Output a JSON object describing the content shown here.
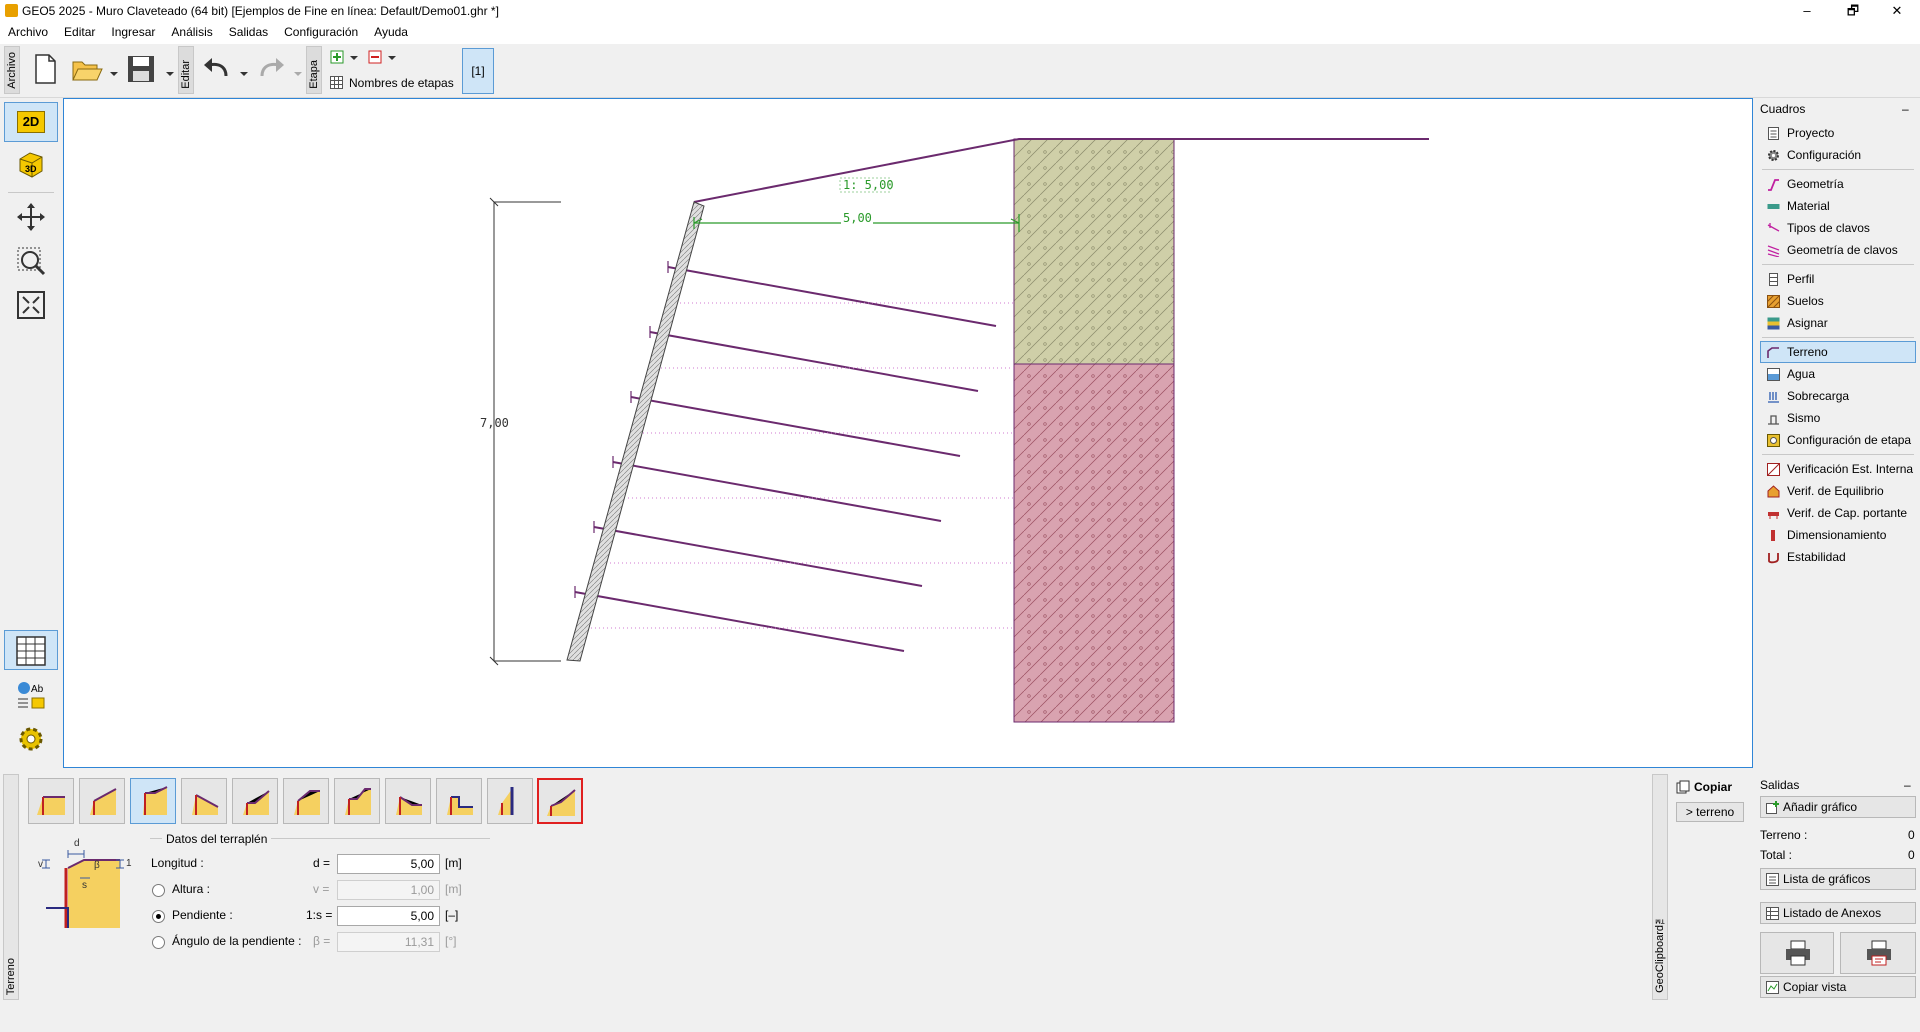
{
  "window": {
    "title": "GEO5 2025 - Muro Claveteado (64 bit) [Ejemplos de Fine en línea: Default/Demo01.ghr *]",
    "minimize": "–",
    "maximize": "🗗",
    "close": "✕"
  },
  "menu": [
    "Archivo",
    "Editar",
    "Ingresar",
    "Análisis",
    "Salidas",
    "Configuración",
    "Ayuda"
  ],
  "toolbar": {
    "tab_archivo": "Archivo",
    "tab_editar": "Editar",
    "tab_etapa": "Etapa",
    "stage_names": "Nombres de etapas",
    "stage_button": "[1]"
  },
  "left_tools": {
    "btn_2d": "2D",
    "btn_3d": "3D"
  },
  "drawing": {
    "slope_label": "1: 5,00",
    "length_label": "5,00",
    "height_label": "7,00"
  },
  "right_panel": {
    "title": "Cuadros",
    "collapse": "–",
    "items": [
      "Proyecto",
      "Configuración",
      "Geometría",
      "Material",
      "Tipos de clavos",
      "Geometría de clavos",
      "Perfil",
      "Suelos",
      "Asignar",
      "Terreno",
      "Agua",
      "Sobrecarga",
      "Sismo",
      "Configuración de etapa",
      "Verificación Est. Interna",
      "Verif. de Equilibrio",
      "Verif. de Cap. portante",
      "Dimensionamiento",
      "Estabilidad"
    ]
  },
  "bottom": {
    "side_tab": "Terreno",
    "group_title": "Datos del terraplén",
    "sketch_labels": {
      "d": "d",
      "v": "v",
      "beta": "β",
      "s": "s",
      "one": "1"
    },
    "rows": [
      {
        "label": "Longitud :",
        "symbol": "d =",
        "value": "5,00",
        "unit": "[m]"
      },
      {
        "label": "Altura :",
        "symbol": "v =",
        "value": "1,00",
        "unit": "[m]"
      },
      {
        "label": "Pendiente :",
        "symbol": "1:s =",
        "value": "5,00",
        "unit": "[–]"
      },
      {
        "label": "Ángulo de la pendiente :",
        "symbol": "β =",
        "value": "11,31",
        "unit": "[°]"
      }
    ],
    "clipboard": {
      "copy_label": "Copiar",
      "terreno_btn": "> terreno",
      "vertical_label": "GeoClipboard™"
    },
    "outputs": {
      "title": "Salidas",
      "collapse": "–",
      "add_graph": "Añadir gráfico",
      "terreno_label": "Terreno :",
      "terreno_count": "0",
      "total_label": "Total :",
      "total_count": "0",
      "graph_list": "Lista de gráficos",
      "annex_list": "Listado de Anexos",
      "copy_view": "Copiar vista"
    }
  },
  "colors": {
    "accent": "#2f85d6",
    "wall": "#6b2a6e",
    "soil_top": "#cfcfa8",
    "soil_bottom": "#d9a3b0",
    "dimension_green": "#2a9a2a"
  }
}
